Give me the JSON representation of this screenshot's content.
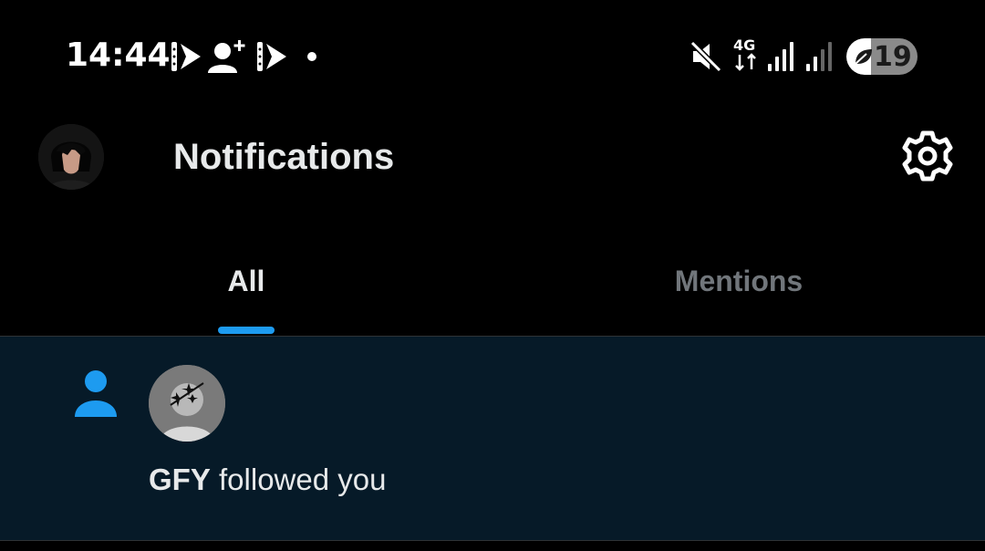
{
  "status_bar": {
    "time": "14:44",
    "battery_level": "19",
    "battery_fraction": 0.19,
    "network": "4G",
    "icons": [
      "media-play-icon",
      "add-person-icon",
      "media-play-icon",
      "dot-icon",
      "mute-icon",
      "network-4g-icon",
      "signal-icon",
      "signal-icon",
      "battery-icon"
    ]
  },
  "header": {
    "title": "Notifications",
    "settings_icon": "gear-icon"
  },
  "tabs": [
    {
      "label": "All",
      "selected": true
    },
    {
      "label": "Mentions",
      "selected": false
    }
  ],
  "notifications": [
    {
      "type": "follow",
      "icon": "person-icon",
      "username": "GFY",
      "action": "followed you"
    }
  ],
  "colors": {
    "accent": "#1d9bf0",
    "background": "#000000",
    "unread_background": "#061a28",
    "text_primary": "#e7e9ea",
    "text_secondary": "#71767b"
  }
}
